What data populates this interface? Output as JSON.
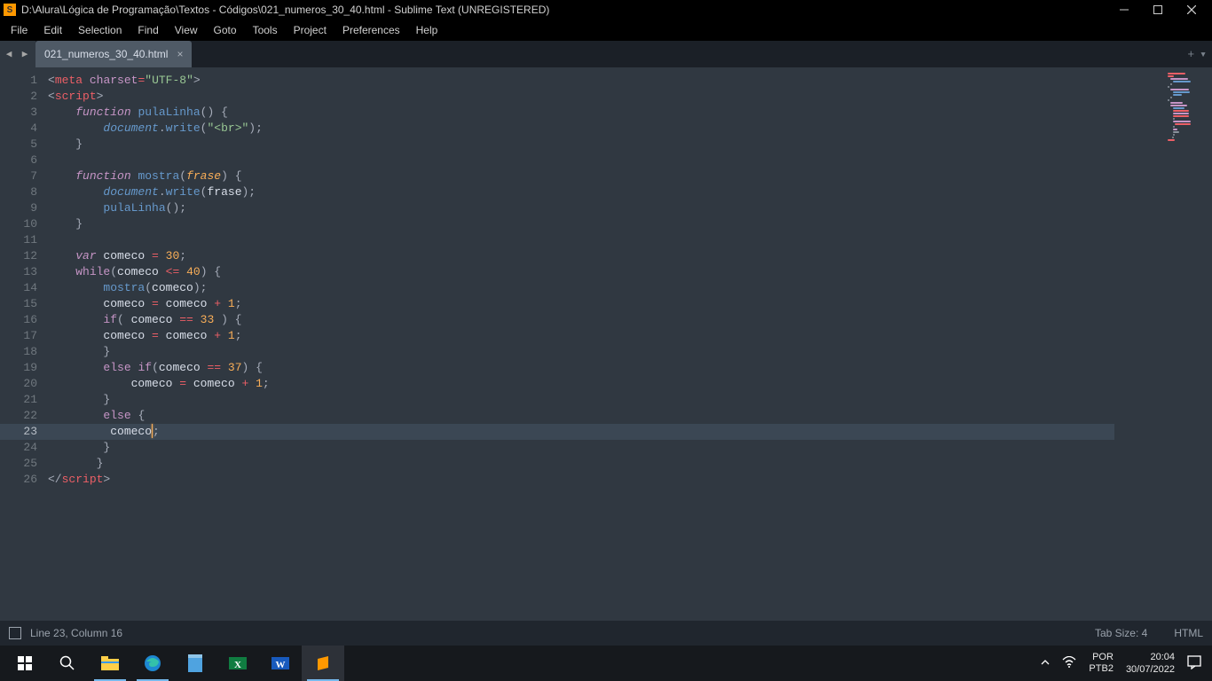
{
  "window": {
    "title": "D:\\Alura\\Lógica de Programação\\Textos - Códigos\\021_numeros_30_40.html - Sublime Text (UNREGISTERED)"
  },
  "menu": {
    "items": [
      "File",
      "Edit",
      "Selection",
      "Find",
      "View",
      "Goto",
      "Tools",
      "Project",
      "Preferences",
      "Help"
    ]
  },
  "tab": {
    "name": "021_numeros_30_40.html"
  },
  "code": {
    "lines": [
      [
        [
          "punc",
          "<"
        ],
        [
          "tag",
          "meta"
        ],
        [
          "vartxt",
          " "
        ],
        [
          "attr",
          "charset"
        ],
        [
          "op",
          "="
        ],
        [
          "str",
          "\"UTF-8\""
        ],
        [
          "punc",
          ">"
        ]
      ],
      [
        [
          "punc",
          "<"
        ],
        [
          "tag",
          "script"
        ],
        [
          "punc",
          ">"
        ]
      ],
      [
        [
          "vartxt",
          "    "
        ],
        [
          "kw",
          "function"
        ],
        [
          "vartxt",
          " "
        ],
        [
          "fname",
          "pulaLinha"
        ],
        [
          "punc",
          "() {"
        ]
      ],
      [
        [
          "vartxt",
          "        "
        ],
        [
          "supp",
          "document"
        ],
        [
          "punc",
          "."
        ],
        [
          "memb",
          "write"
        ],
        [
          "punc",
          "("
        ],
        [
          "str",
          "\"<br>\""
        ],
        [
          "punc",
          ");"
        ]
      ],
      [
        [
          "vartxt",
          "    "
        ],
        [
          "punc",
          "}"
        ]
      ],
      [
        [
          "vartxt",
          ""
        ]
      ],
      [
        [
          "vartxt",
          "    "
        ],
        [
          "kw",
          "function"
        ],
        [
          "vartxt",
          " "
        ],
        [
          "fname",
          "mostra"
        ],
        [
          "punc",
          "("
        ],
        [
          "param",
          "frase"
        ],
        [
          "punc",
          ") {"
        ]
      ],
      [
        [
          "vartxt",
          "        "
        ],
        [
          "supp",
          "document"
        ],
        [
          "punc",
          "."
        ],
        [
          "memb",
          "write"
        ],
        [
          "punc",
          "("
        ],
        [
          "vartxt",
          "frase"
        ],
        [
          "punc",
          ");"
        ]
      ],
      [
        [
          "vartxt",
          "        "
        ],
        [
          "memb",
          "pulaLinha"
        ],
        [
          "punc",
          "();"
        ]
      ],
      [
        [
          "vartxt",
          "    "
        ],
        [
          "punc",
          "}"
        ]
      ],
      [
        [
          "vartxt",
          ""
        ]
      ],
      [
        [
          "vartxt",
          "    "
        ],
        [
          "kw",
          "var"
        ],
        [
          "vartxt",
          " comeco "
        ],
        [
          "op",
          "="
        ],
        [
          "vartxt",
          " "
        ],
        [
          "num",
          "30"
        ],
        [
          "punc",
          ";"
        ]
      ],
      [
        [
          "vartxt",
          "    "
        ],
        [
          "kw2",
          "while"
        ],
        [
          "punc",
          "("
        ],
        [
          "vartxt",
          "comeco "
        ],
        [
          "op",
          "<="
        ],
        [
          "vartxt",
          " "
        ],
        [
          "num",
          "40"
        ],
        [
          "punc",
          ") {"
        ]
      ],
      [
        [
          "vartxt",
          "        "
        ],
        [
          "memb",
          "mostra"
        ],
        [
          "punc",
          "("
        ],
        [
          "vartxt",
          "comeco"
        ],
        [
          "punc",
          ");"
        ]
      ],
      [
        [
          "vartxt",
          "        comeco "
        ],
        [
          "op",
          "="
        ],
        [
          "vartxt",
          " comeco "
        ],
        [
          "op",
          "+"
        ],
        [
          "vartxt",
          " "
        ],
        [
          "num",
          "1"
        ],
        [
          "punc",
          ";"
        ]
      ],
      [
        [
          "vartxt",
          "        "
        ],
        [
          "kw2",
          "if"
        ],
        [
          "punc",
          "( "
        ],
        [
          "vartxt",
          "comeco "
        ],
        [
          "op",
          "=="
        ],
        [
          "vartxt",
          " "
        ],
        [
          "num",
          "33"
        ],
        [
          "punc",
          " ) {"
        ]
      ],
      [
        [
          "vartxt",
          "        comeco "
        ],
        [
          "op",
          "="
        ],
        [
          "vartxt",
          " comeco "
        ],
        [
          "op",
          "+"
        ],
        [
          "vartxt",
          " "
        ],
        [
          "num",
          "1"
        ],
        [
          "punc",
          ";"
        ]
      ],
      [
        [
          "vartxt",
          "        "
        ],
        [
          "punc",
          "}"
        ]
      ],
      [
        [
          "vartxt",
          "        "
        ],
        [
          "kw2",
          "else"
        ],
        [
          "vartxt",
          " "
        ],
        [
          "kw2",
          "if"
        ],
        [
          "punc",
          "("
        ],
        [
          "vartxt",
          "comeco "
        ],
        [
          "op",
          "=="
        ],
        [
          "vartxt",
          " "
        ],
        [
          "num",
          "37"
        ],
        [
          "punc",
          ") {"
        ]
      ],
      [
        [
          "vartxt",
          "            comeco "
        ],
        [
          "op",
          "="
        ],
        [
          "vartxt",
          " comeco "
        ],
        [
          "op",
          "+"
        ],
        [
          "vartxt",
          " "
        ],
        [
          "num",
          "1"
        ],
        [
          "punc",
          ";"
        ]
      ],
      [
        [
          "vartxt",
          "        "
        ],
        [
          "punc",
          "}"
        ]
      ],
      [
        [
          "vartxt",
          "        "
        ],
        [
          "kw2",
          "else"
        ],
        [
          "vartxt",
          " "
        ],
        [
          "punc",
          "{"
        ]
      ],
      [
        [
          "vartxt",
          "         comeco"
        ],
        [
          "cursor",
          ""
        ],
        [
          "punc",
          ";"
        ]
      ],
      [
        [
          "vartxt",
          "        "
        ],
        [
          "punc",
          "}"
        ]
      ],
      [
        [
          "vartxt",
          "       "
        ],
        [
          "punc",
          "}"
        ]
      ],
      [
        [
          "punc",
          "</"
        ],
        [
          "tag",
          "script"
        ],
        [
          "punc",
          ">"
        ]
      ]
    ],
    "activeLine": 23
  },
  "status": {
    "pos": "Line 23, Column 16",
    "tabsize": "Tab Size: 4",
    "syntax": "HTML"
  },
  "taskbar": {
    "lang": "POR",
    "kb": "PTB2",
    "time": "20:04",
    "date": "30/07/2022"
  }
}
